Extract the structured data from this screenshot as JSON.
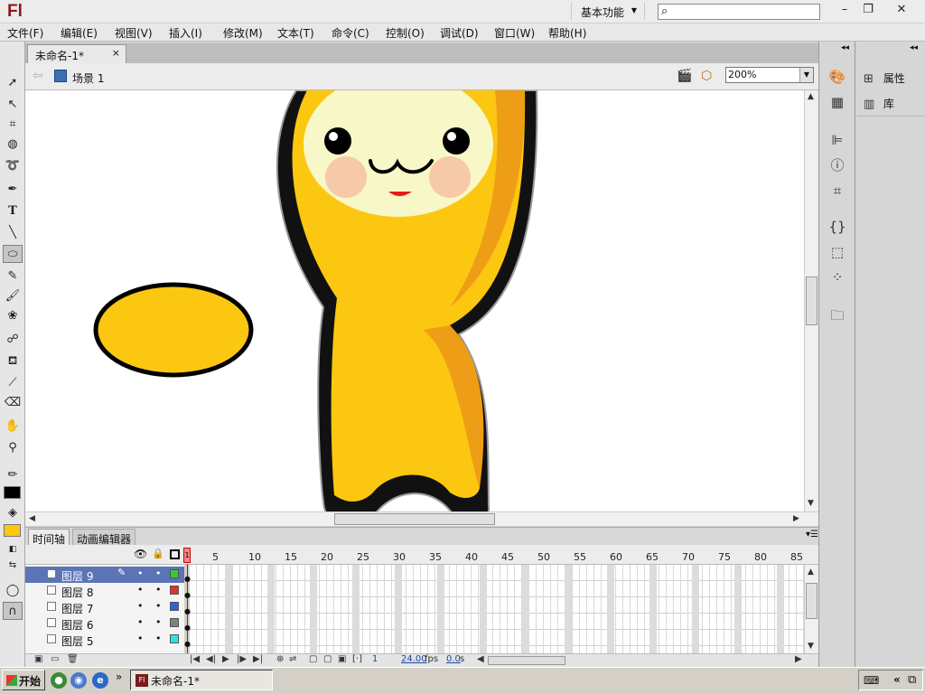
{
  "app": {
    "logo": "Fl"
  },
  "titlebar": {
    "workspace": "基本功能",
    "search_placeholder": "",
    "min": "–",
    "max": "❐",
    "close": "✕"
  },
  "menu": [
    "文件(F)",
    "编辑(E)",
    "视图(V)",
    "插入(I)",
    "修改(M)",
    "文本(T)",
    "命令(C)",
    "控制(O)",
    "调试(D)",
    "窗口(W)",
    "帮助(H)"
  ],
  "document": {
    "tab_title": "未命名-1*",
    "close": "×"
  },
  "scene": {
    "label": "场景 1",
    "zoom": "200%"
  },
  "timeline": {
    "tabs": [
      "时间轴",
      "动画编辑器"
    ],
    "frame_numbers": [
      "1",
      "5",
      "10",
      "15",
      "20",
      "25",
      "30",
      "35",
      "40",
      "45",
      "50",
      "55",
      "60",
      "65",
      "70",
      "75",
      "80",
      "85"
    ],
    "layers": [
      {
        "name": "图层 9",
        "selected": true,
        "color": "#33cc33"
      },
      {
        "name": "图层 8",
        "selected": false,
        "color": "#e03030"
      },
      {
        "name": "图层 7",
        "selected": false,
        "color": "#3060e0"
      },
      {
        "name": "图层 6",
        "selected": false,
        "color": "#808080"
      },
      {
        "name": "图层 5",
        "selected": false,
        "color": "#30e0e0"
      }
    ],
    "status": {
      "current_frame": "1",
      "fps": "24.00",
      "fps_unit": "fps",
      "time": "0.0",
      "time_unit": "s"
    }
  },
  "right_panel": {
    "items": [
      "属性",
      "库"
    ]
  },
  "colors": {
    "stroke": "#000000",
    "fill": "#fcc711"
  },
  "taskbar": {
    "start": "开始",
    "task": "未命名-1*",
    "more": "»",
    "tray_arrow": "«"
  }
}
